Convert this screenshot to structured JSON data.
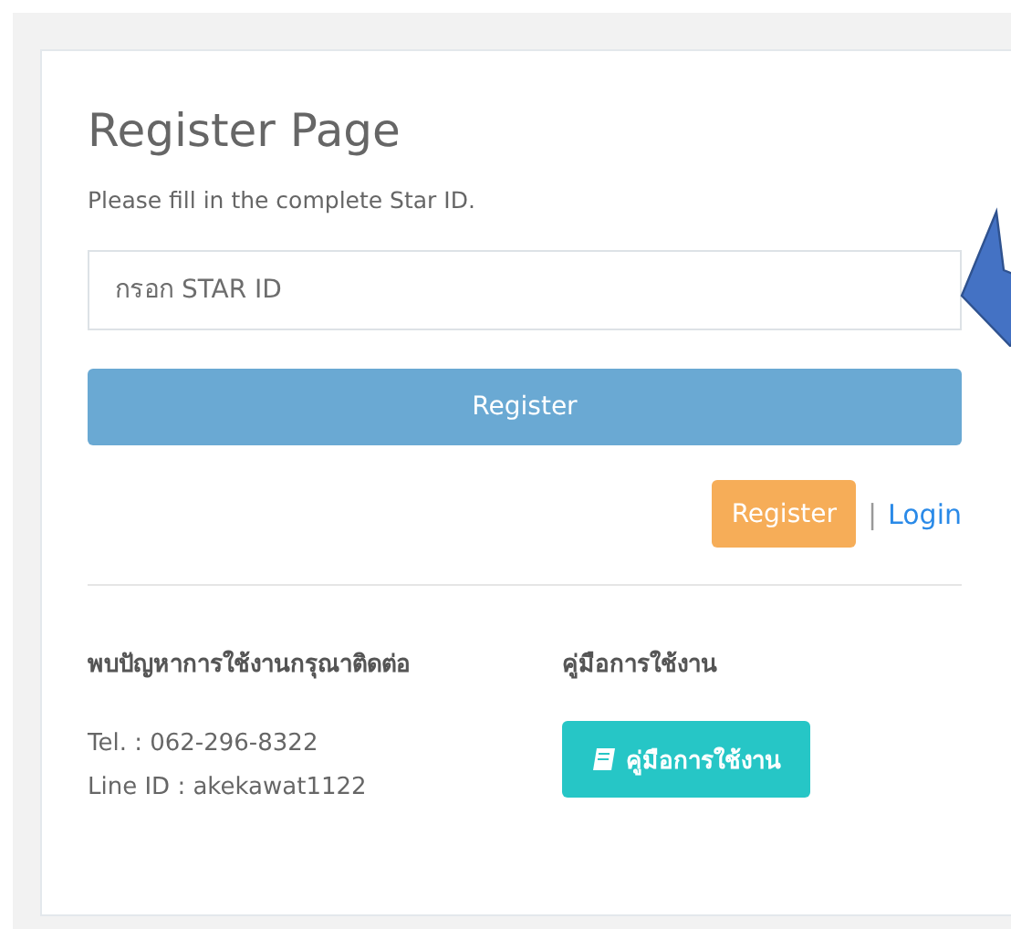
{
  "title": "Register Page",
  "subtitle": "Please fill in the complete Star ID.",
  "star_id_field": {
    "placeholder": "กรอก STAR ID"
  },
  "register_button": {
    "label": "Register",
    "disabled": true
  },
  "links": [
    {
      "label": "Register",
      "kind": "button"
    },
    {
      "label": "|",
      "kind": "separator"
    },
    {
      "label": "Login",
      "kind": "link"
    }
  ],
  "contact": {
    "heading": "พบปัญหาการใช้งานกรุณาติดต่อ",
    "lines": [
      "Tel. : 062-296-8322",
      "Line ID : akekawat1122"
    ]
  },
  "manual": {
    "heading": "คู่มือการใช้งาน",
    "button": "คู่มือการใช้งาน"
  }
}
